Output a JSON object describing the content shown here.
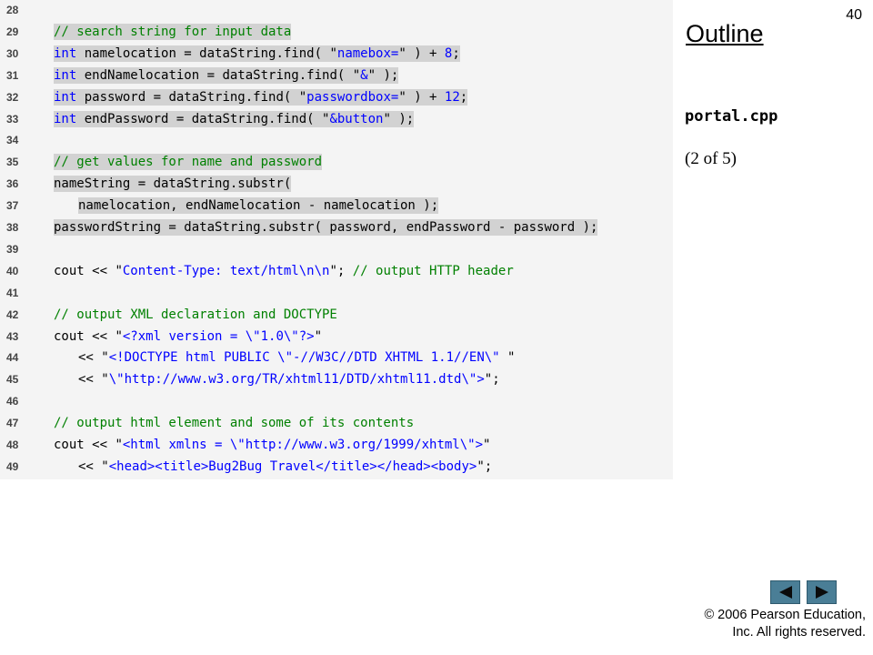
{
  "slide": {
    "page_number": "40",
    "outline_title": "Outline",
    "filename": "portal.cpp",
    "page_info": "(2 of 5)",
    "copyright_line1": "© 2006 Pearson Education,",
    "copyright_line2": "Inc.  All rights reserved."
  },
  "navigation": {
    "prev_icon": "triangle-left-icon",
    "next_icon": "triangle-right-icon",
    "button_color": "#4a7e96"
  },
  "colors": {
    "keyword": "#0000ff",
    "string": "#0000ff",
    "comment": "#008000",
    "highlight": "#d2d2d2",
    "panel": "#f4f4f4"
  },
  "code_lines": [
    {
      "num": "28",
      "highlight": false,
      "indent": 0,
      "tokens": []
    },
    {
      "num": "29",
      "highlight": true,
      "indent": 0,
      "tokens": [
        {
          "t": "cm",
          "v": "// search string for input data"
        }
      ]
    },
    {
      "num": "30",
      "highlight": true,
      "indent": 0,
      "tokens": [
        {
          "t": "kw",
          "v": "int"
        },
        {
          "t": "plain",
          "v": " namelocation = dataString.find( "
        },
        {
          "t": "str",
          "v": "\""
        },
        {
          "t": "strtext",
          "v": "namebox="
        },
        {
          "t": "str",
          "v": "\""
        },
        {
          "t": "plain",
          "v": " ) + "
        },
        {
          "t": "num",
          "v": "8"
        },
        {
          "t": "plain",
          "v": ";"
        }
      ]
    },
    {
      "num": "31",
      "highlight": true,
      "indent": 0,
      "tokens": [
        {
          "t": "kw",
          "v": "int"
        },
        {
          "t": "plain",
          "v": " endNamelocation = dataString.find( "
        },
        {
          "t": "str",
          "v": "\""
        },
        {
          "t": "strtext",
          "v": "&"
        },
        {
          "t": "str",
          "v": "\""
        },
        {
          "t": "plain",
          "v": " );"
        }
      ]
    },
    {
      "num": "32",
      "highlight": true,
      "indent": 0,
      "tokens": [
        {
          "t": "kw",
          "v": "int"
        },
        {
          "t": "plain",
          "v": " password = dataString.find( "
        },
        {
          "t": "str",
          "v": "\""
        },
        {
          "t": "strtext",
          "v": "passwordbox="
        },
        {
          "t": "str",
          "v": "\""
        },
        {
          "t": "plain",
          "v": " ) + "
        },
        {
          "t": "num",
          "v": "12"
        },
        {
          "t": "plain",
          "v": ";"
        }
      ]
    },
    {
      "num": "33",
      "highlight": true,
      "indent": 0,
      "tokens": [
        {
          "t": "kw",
          "v": "int"
        },
        {
          "t": "plain",
          "v": " endPassword = dataString.find( "
        },
        {
          "t": "str",
          "v": "\""
        },
        {
          "t": "strtext",
          "v": "&button"
        },
        {
          "t": "str",
          "v": "\""
        },
        {
          "t": "plain",
          "v": " );"
        }
      ]
    },
    {
      "num": "34",
      "highlight": false,
      "indent": 0,
      "tokens": []
    },
    {
      "num": "35",
      "highlight": true,
      "indent": 0,
      "tokens": [
        {
          "t": "cm",
          "v": "// get values for name and password"
        }
      ]
    },
    {
      "num": "36",
      "highlight": true,
      "indent": 0,
      "tokens": [
        {
          "t": "plain",
          "v": "nameString = dataString.substr("
        }
      ]
    },
    {
      "num": "37",
      "highlight": true,
      "indent": 1,
      "tokens": [
        {
          "t": "plain",
          "v": "namelocation, endNamelocation - namelocation );"
        }
      ]
    },
    {
      "num": "38",
      "highlight": true,
      "indent": 0,
      "tokens": [
        {
          "t": "plain",
          "v": "passwordString = dataString.substr( password, endPassword - password );"
        }
      ]
    },
    {
      "num": "39",
      "highlight": false,
      "indent": 0,
      "tokens": []
    },
    {
      "num": "40",
      "highlight": false,
      "indent": 0,
      "tokens": [
        {
          "t": "plain",
          "v": "cout << "
        },
        {
          "t": "str",
          "v": "\""
        },
        {
          "t": "strtext",
          "v": "Content-Type: text/html\\n\\n"
        },
        {
          "t": "str",
          "v": "\""
        },
        {
          "t": "plain",
          "v": "; "
        },
        {
          "t": "cm",
          "v": "// output HTTP header"
        }
      ]
    },
    {
      "num": "41",
      "highlight": false,
      "indent": 0,
      "tokens": []
    },
    {
      "num": "42",
      "highlight": false,
      "indent": 0,
      "tokens": [
        {
          "t": "cm",
          "v": "// output XML declaration and DOCTYPE"
        }
      ]
    },
    {
      "num": "43",
      "highlight": false,
      "indent": 0,
      "tokens": [
        {
          "t": "plain",
          "v": "cout << "
        },
        {
          "t": "str",
          "v": "\""
        },
        {
          "t": "strtext",
          "v": "<?xml version = \\\"1.0\\\"?>"
        },
        {
          "t": "str",
          "v": "\""
        }
      ]
    },
    {
      "num": "44",
      "highlight": false,
      "indent": 1,
      "tokens": [
        {
          "t": "plain",
          "v": "<< "
        },
        {
          "t": "str",
          "v": "\""
        },
        {
          "t": "strtext",
          "v": "<!DOCTYPE html PUBLIC \\\"-//W3C//DTD XHTML 1.1//EN\\\" "
        },
        {
          "t": "str",
          "v": "\""
        }
      ]
    },
    {
      "num": "45",
      "highlight": false,
      "indent": 1,
      "tokens": [
        {
          "t": "plain",
          "v": "<< "
        },
        {
          "t": "str",
          "v": "\""
        },
        {
          "t": "strtext",
          "v": "\\\"http://www.w3.org/TR/xhtml11/DTD/xhtml11.dtd\\\">"
        },
        {
          "t": "str",
          "v": "\""
        },
        {
          "t": "plain",
          "v": ";"
        }
      ]
    },
    {
      "num": "46",
      "highlight": false,
      "indent": 0,
      "tokens": []
    },
    {
      "num": "47",
      "highlight": false,
      "indent": 0,
      "tokens": [
        {
          "t": "cm",
          "v": "// output html element and some of its contents"
        }
      ]
    },
    {
      "num": "48",
      "highlight": false,
      "indent": 0,
      "tokens": [
        {
          "t": "plain",
          "v": "cout << "
        },
        {
          "t": "str",
          "v": "\""
        },
        {
          "t": "strtext",
          "v": "<html xmlns = \\\"http://www.w3.org/1999/xhtml\\\">"
        },
        {
          "t": "str",
          "v": "\""
        }
      ]
    },
    {
      "num": "49",
      "highlight": false,
      "indent": 1,
      "tokens": [
        {
          "t": "plain",
          "v": "<< "
        },
        {
          "t": "str",
          "v": "\""
        },
        {
          "t": "strtext",
          "v": "<head><title>Bug2Bug Travel</title></head><body>"
        },
        {
          "t": "str",
          "v": "\""
        },
        {
          "t": "plain",
          "v": ";"
        }
      ]
    }
  ]
}
